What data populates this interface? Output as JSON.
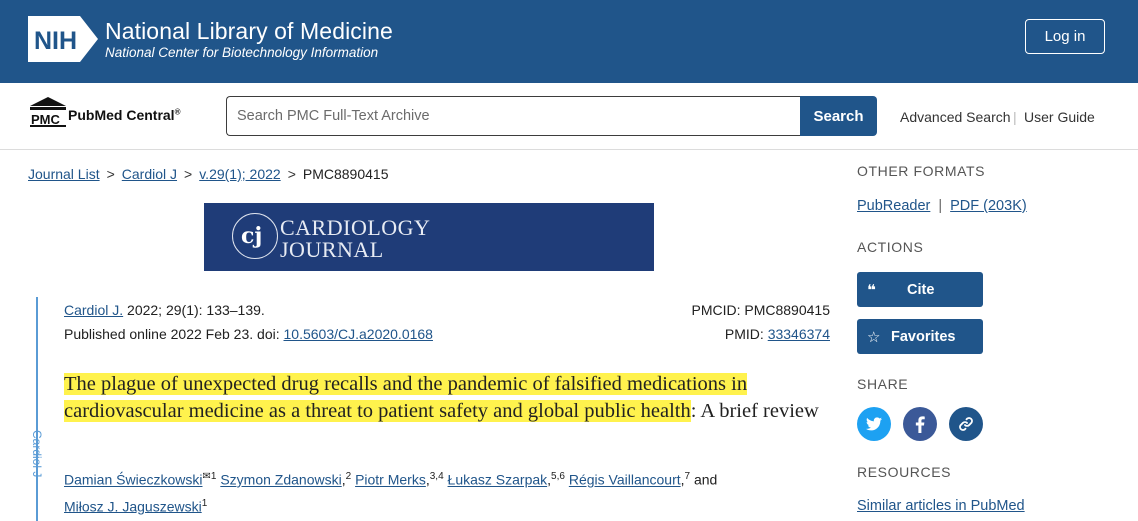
{
  "header": {
    "org_logo": "NIH",
    "title": "National Library of Medicine",
    "subtitle": "National Center for Biotechnology Information",
    "login_label": "Log in"
  },
  "search": {
    "logo_text": "PubMed Central",
    "logo_abbr": "PMC",
    "placeholder": "Search PMC Full-Text Archive",
    "button_label": "Search",
    "advanced_label": "Advanced Search",
    "guide_label": "User Guide"
  },
  "breadcrumb": {
    "items": [
      "Journal List",
      "Cardiol J",
      "v.29(1); 2022"
    ],
    "current": "PMC8890415"
  },
  "journal_banner": {
    "abbr": "cj",
    "line1": "CARDIOLOGY",
    "line2": "JOURNAL"
  },
  "citation": {
    "journal": "Cardiol J.",
    "details": " 2022; 29(1): 133–139.",
    "published": "Published online 2022 Feb 23. doi: ",
    "doi": "10.5603/CJ.a2020.0168",
    "pmcid_label": "PMCID: ",
    "pmcid": "PMC8890415",
    "pmid_label": "PMID: ",
    "pmid": "33346374",
    "side_label": "Cardiol J"
  },
  "article": {
    "title_highlighted": "The plague of unexpected drug recalls and the pandemic of falsified medications in cardiovascular medicine as a threat to patient safety and global public health",
    "title_rest": ": A brief review",
    "authors": [
      {
        "name": "Damian Świeczkowski",
        "sup": "1"
      },
      {
        "name": "Szymon Zdanowski",
        "sup": "2"
      },
      {
        "name": "Piotr Merks",
        "sup": "3,4"
      },
      {
        "name": "Łukasz Szarpak",
        "sup": "5,6"
      },
      {
        "name": "Régis Vaillancourt",
        "sup": "7"
      },
      {
        "name": "Miłosz J. Jaguszewski",
        "sup": "1"
      }
    ],
    "and_word": "and"
  },
  "sidebar": {
    "formats_heading": "OTHER FORMATS",
    "pubreader": "PubReader",
    "pdf": "PDF (203K)",
    "actions_heading": "ACTIONS",
    "cite_label": "Cite",
    "favorites_label": "Favorites",
    "share_heading": "SHARE",
    "resources_heading": "RESOURCES",
    "similar_label": "Similar articles in PubMed"
  },
  "colors": {
    "brand": "#20558a",
    "highlight": "#fff24d",
    "twitter": "#1da1f2",
    "facebook": "#3b5998",
    "link_share": "#20558a"
  },
  "icons": [
    "nih-logo-icon",
    "pmc-building-icon",
    "quote-icon",
    "star-icon",
    "twitter-icon",
    "facebook-icon",
    "link-icon"
  ]
}
